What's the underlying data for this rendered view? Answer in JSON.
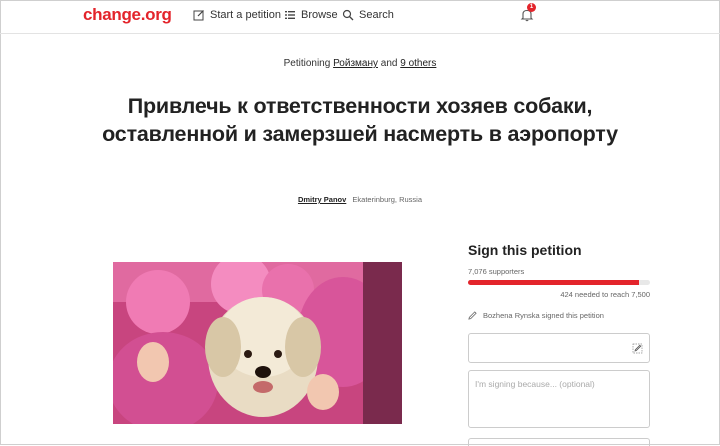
{
  "header": {
    "logo": "change.org",
    "start_petition": "Start a petition",
    "browse": "Browse",
    "search": "Search",
    "notification_count": "1"
  },
  "petition": {
    "petitioning_prefix": "Petitioning",
    "target": "Ройзману",
    "and_word": "and",
    "others": "9 others",
    "title": "Привлечь к ответственности хозяев собаки, оставленной и замерзшей насмерть в аэропорту",
    "author_name": "Dmitry Panov",
    "author_location": "Ekaterinburg, Russia"
  },
  "sign": {
    "title": "Sign this petition",
    "supporters": "7,076 supporters",
    "progress_fraction": 0.942,
    "needed": "424 needed to reach 7,500",
    "recent_signer": "Bozhena Rynska signed this petition",
    "reason_placeholder": "I'm signing because... (optional)"
  },
  "colors": {
    "brand": "#e3242b",
    "photo_pink": "#d64c8c"
  }
}
